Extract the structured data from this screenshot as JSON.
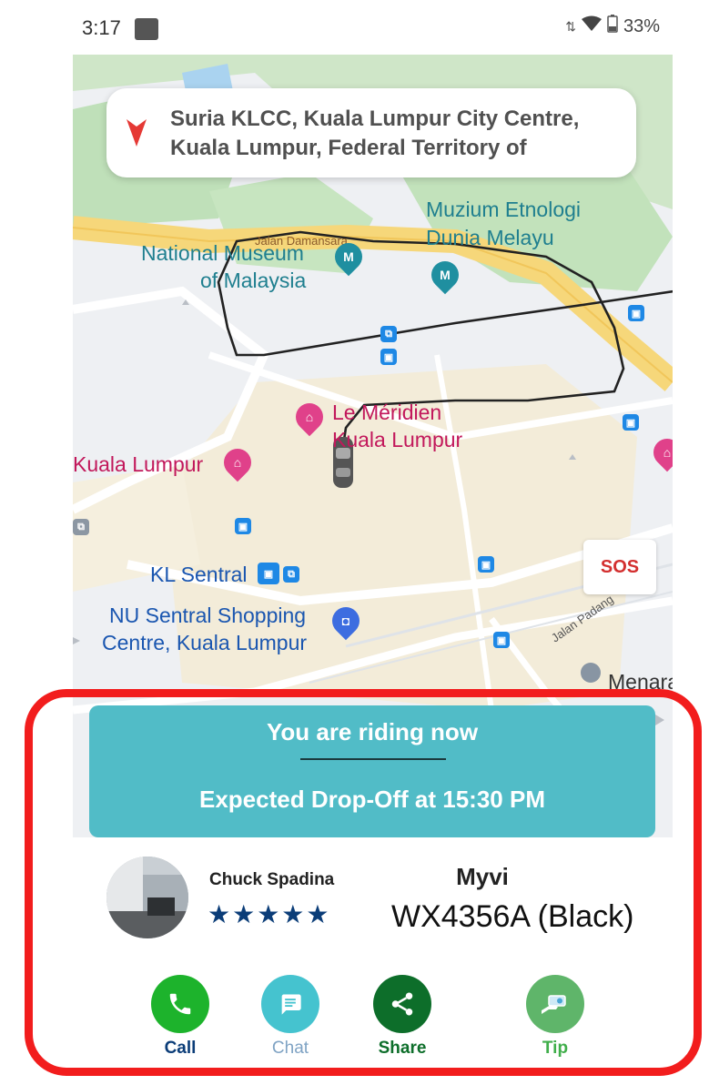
{
  "status_bar": {
    "time": "3:17",
    "battery": "33%",
    "icons": [
      "notification-square-icon",
      "data-arrows-icon",
      "wifi-icon",
      "battery-icon"
    ]
  },
  "search": {
    "destination": "Suria KLCC, Kuala Lumpur City Centre, Kuala Lumpur, Federal Territory of"
  },
  "map": {
    "labels": {
      "muzium_1": "Muzium Etnologi",
      "muzium_2": "Dunia Melayu",
      "national_1": "National Museum",
      "national_2": "of Malaysia",
      "jalan_damansara": "Jalan Damansara",
      "meridien_1": "Le Méridien",
      "meridien_2": "Kuala Lumpur",
      "kuala_lumpur_left": "Kuala Lumpur",
      "kl_sentral": "KL Sentral",
      "nu_sentral_1": "NU Sentral Shopping",
      "nu_sentral_2": "Centre, Kuala Lumpur",
      "jalan_padang": "Jalan Padang",
      "menara": "Menara"
    }
  },
  "sos": {
    "label": "SOS"
  },
  "ride": {
    "status": "You are riding now",
    "dropoff": "Expected Drop-Off at 15:30 PM"
  },
  "driver": {
    "name": "Chuck Spadina",
    "stars": "★★★★★",
    "rating": 5
  },
  "vehicle": {
    "model": "Myvi",
    "plate": "WX4356A (Black)"
  },
  "actions": {
    "call": "Call",
    "chat": "Chat",
    "share": "Share",
    "tip": "Tip"
  },
  "colors": {
    "banner": "#51bcc7",
    "call": "#1db32c",
    "chat": "#45c3cf",
    "share": "#0d6e2a",
    "tip": "#5fb56a",
    "highlight": "#f21d1d",
    "sos": "#d32f2f"
  }
}
